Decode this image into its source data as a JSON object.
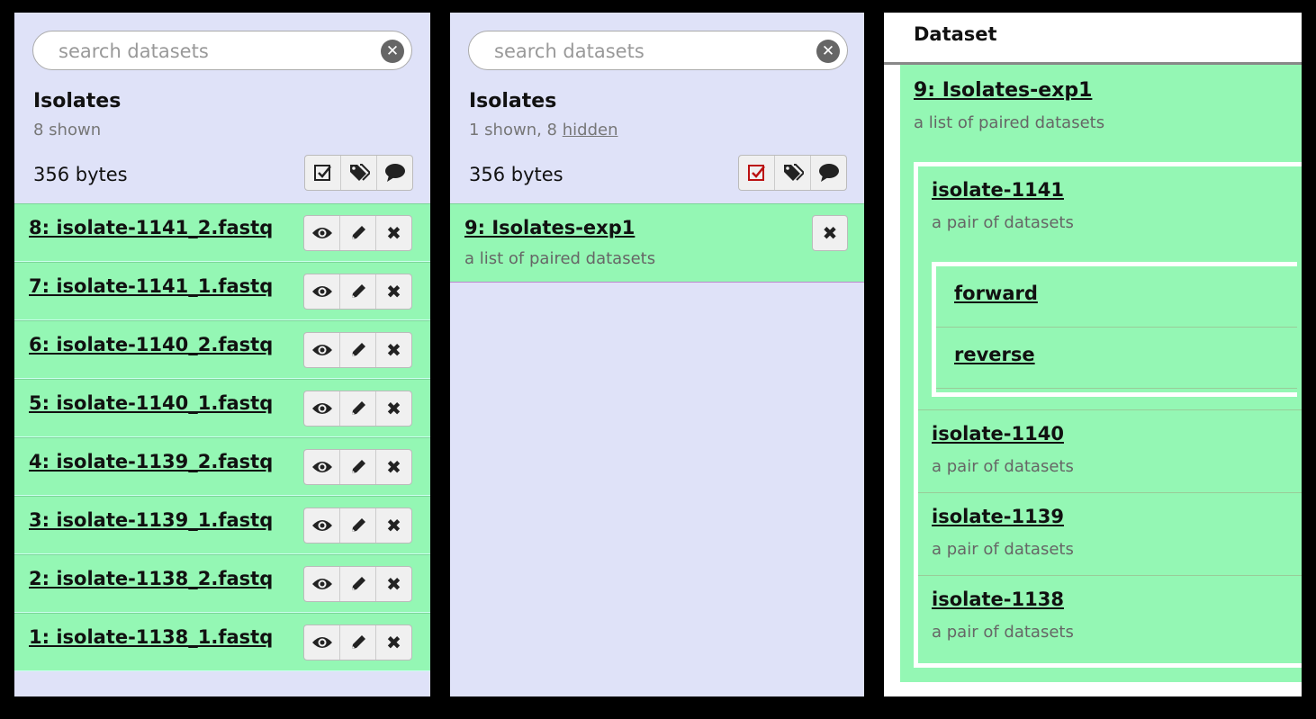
{
  "panels": [
    {
      "search_placeholder": "search datasets",
      "title": "Isolates",
      "shown": "8 shown",
      "size": "356 bytes",
      "datasets": [
        {
          "name": "8: isolate-1141_2.fastq"
        },
        {
          "name": "7: isolate-1141_1.fastq"
        },
        {
          "name": "6: isolate-1140_2.fastq"
        },
        {
          "name": "5: isolate-1140_1.fastq"
        },
        {
          "name": "4: isolate-1139_2.fastq"
        },
        {
          "name": "3: isolate-1139_1.fastq"
        },
        {
          "name": "2: isolate-1138_2.fastq"
        },
        {
          "name": "1: isolate-1138_1.fastq"
        }
      ]
    },
    {
      "search_placeholder": "search datasets",
      "title": "Isolates",
      "shown_prefix": "1 shown, 8 ",
      "hidden_link": "hidden",
      "size": "356 bytes",
      "collection": {
        "name": "9: Isolates-exp1",
        "desc": "a list of paired datasets"
      }
    }
  ],
  "collection_view": {
    "header": "Dataset",
    "title": "9: Isolates-exp1",
    "desc": "a list of paired datasets",
    "pairs": [
      {
        "name": "isolate-1141",
        "desc": "a pair of datasets",
        "items": [
          "forward",
          "reverse"
        ]
      },
      {
        "name": "isolate-1140",
        "desc": "a pair of datasets"
      },
      {
        "name": "isolate-1139",
        "desc": "a pair of datasets"
      },
      {
        "name": "isolate-1138",
        "desc": "a pair of datasets"
      }
    ]
  },
  "colors": {
    "background": "#000000",
    "panel": "#dfe2f8",
    "dataset_ok": "#94f7b4",
    "selected_icon": "#bb1111"
  },
  "icons": {
    "clear": "times-circle-icon",
    "select": "check-square-icon",
    "tags": "tags-icon",
    "annotate": "comment-icon",
    "view": "eye-icon",
    "edit": "pencil-icon",
    "delete": "x-icon"
  }
}
